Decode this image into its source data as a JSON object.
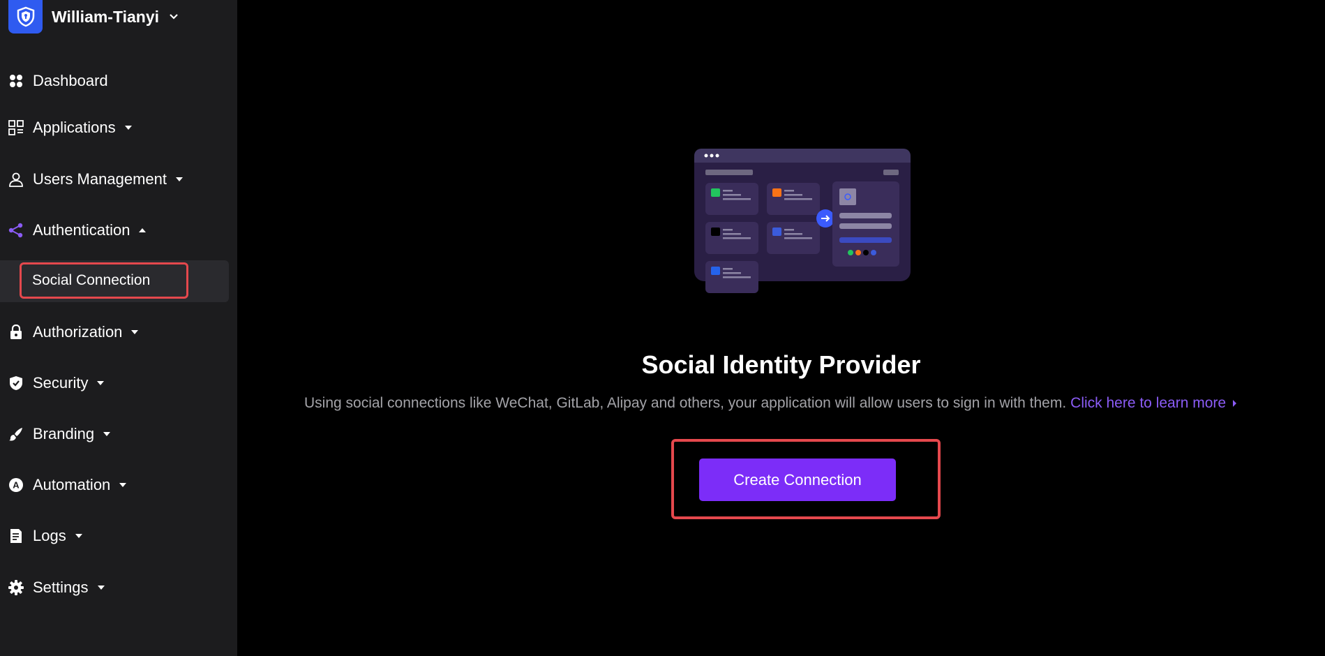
{
  "org": {
    "name": "William-Tianyi"
  },
  "nav": {
    "dashboard": "Dashboard",
    "applications": "Applications",
    "users_management": "Users Management",
    "authentication": "Authentication",
    "social_connection": "Social Connection",
    "authorization": "Authorization",
    "security": "Security",
    "branding": "Branding",
    "automation": "Automation",
    "logs": "Logs",
    "settings": "Settings"
  },
  "main": {
    "title": "Social Identity Provider",
    "description": "Using social connections like WeChat, GitLab, Alipay and others, your application will allow users to sign in with them.",
    "learn_more": "Click here to learn more",
    "create_button": "Create Connection"
  },
  "colors": {
    "accent": "#7c2df8",
    "highlight": "#e5484d",
    "sidebar": "#1c1c1e",
    "link": "#8b5cf6"
  }
}
